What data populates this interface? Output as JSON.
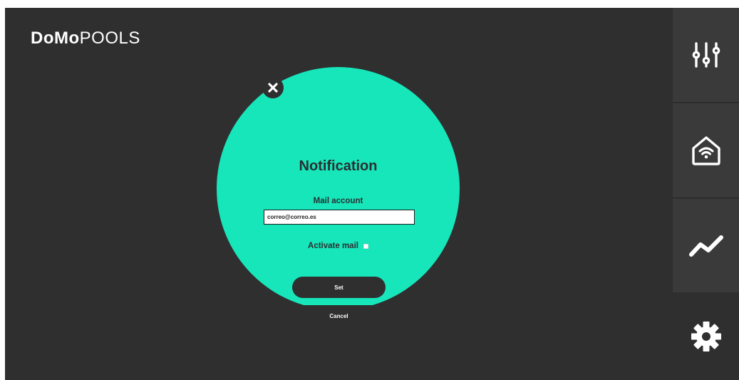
{
  "app": {
    "brand_strong": "DoMo",
    "brand_light": "POOLS"
  },
  "sidebar": {
    "items": [
      {
        "name": "controls",
        "icon": "sliders-icon"
      },
      {
        "name": "smart-home",
        "icon": "wifi-home-icon"
      },
      {
        "name": "charts",
        "icon": "trend-line-icon"
      },
      {
        "name": "settings",
        "icon": "gear-icon"
      }
    ]
  },
  "modal": {
    "title": "Notification",
    "mail_label": "Mail account",
    "mail_value": "correo@correo.es",
    "activate_label": "Activate mail",
    "activate_checked": false,
    "set_label": "Set",
    "cancel_label": "Cancel",
    "close_icon": "close-icon"
  },
  "colors": {
    "background": "#2f2f2f",
    "sidebar_panel": "#3a3a3a",
    "accent": "#17e6bb",
    "text_dark": "#2a2f31",
    "white": "#ffffff"
  }
}
